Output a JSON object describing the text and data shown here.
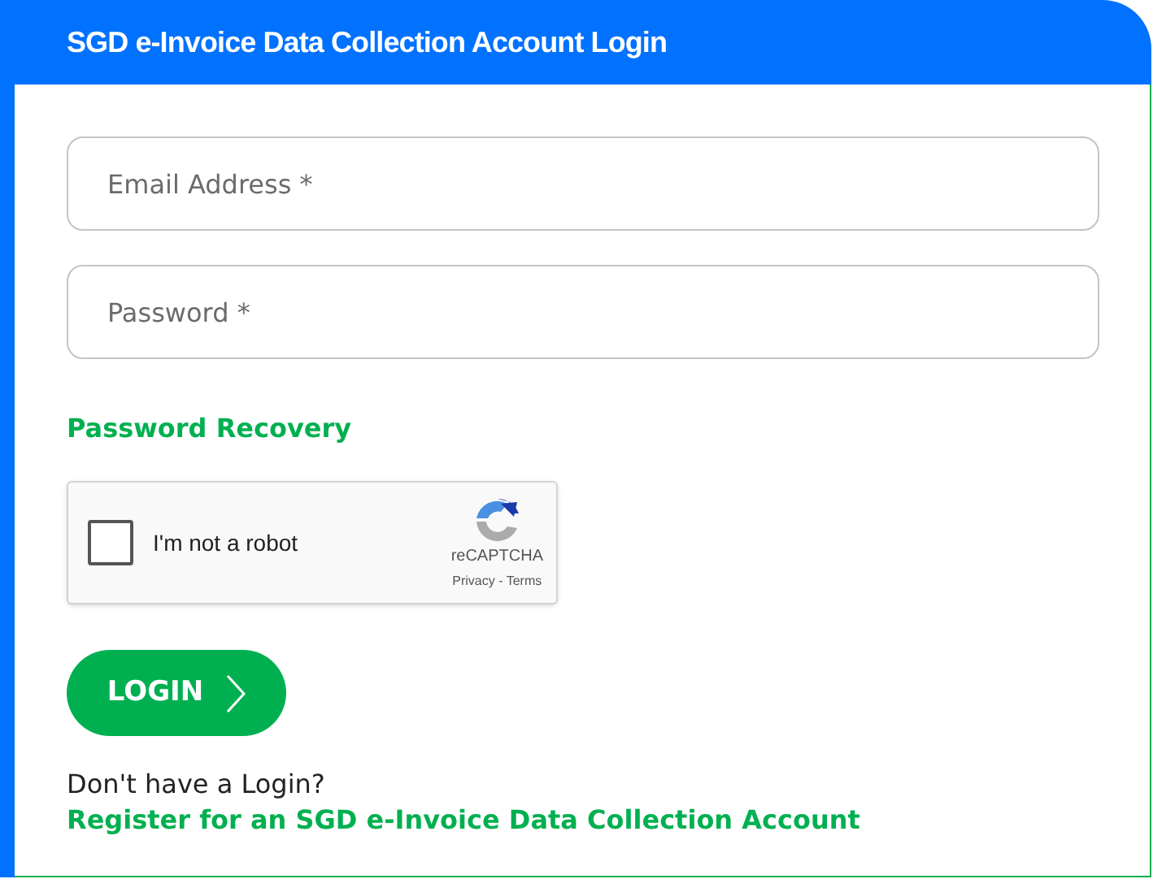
{
  "title": "SGD e-Invoice Data Collection Account Login",
  "fields": [
    {
      "placeholder": "Email Address *"
    },
    {
      "placeholder": "Password *"
    }
  ],
  "recovery_link": "Password Recovery",
  "captcha": {
    "label": "I'm not a robot",
    "checked": false,
    "brand": "reCAPTCHA",
    "privacy": "Privacy",
    "separator": " - ",
    "terms": "Terms"
  },
  "login_button": "LOGIN",
  "register_prompt": "Don't have a Login?",
  "register_link": "Register for an SGD e-Invoice Data Collection Account"
}
